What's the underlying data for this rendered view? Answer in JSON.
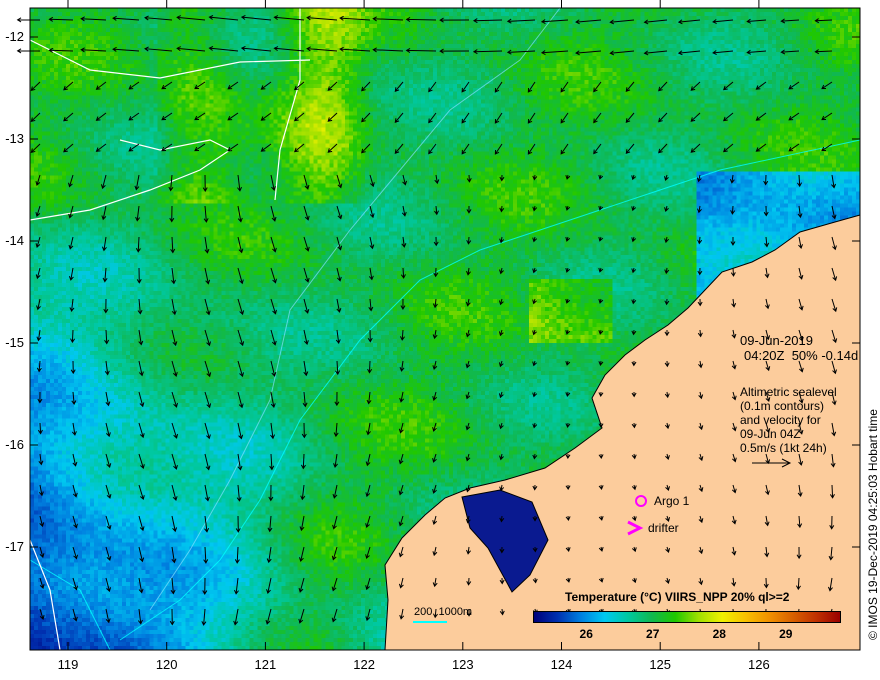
{
  "map": {
    "lat_ticks": [
      "-12",
      "-13",
      "-14",
      "-15",
      "-16",
      "-17"
    ],
    "lon_ticks": [
      "119",
      "120",
      "121",
      "122",
      "123",
      "124",
      "125",
      "126"
    ],
    "date": "09-Jun-2019",
    "time_line": "04:20Z  50% -0.14d",
    "altimetry_lines": [
      "Altimetric sealevel",
      "(0.1m contours)",
      "and velocity for",
      "09-Jun 04Z",
      "0.5m/s (1kt 24h)"
    ],
    "argo_label": "Argo 1",
    "drifter_label": "drifter",
    "depth_label": "200  1000m",
    "credit": "© IMOS 19-Dec-2019 04:25:03 Hobart time",
    "colors": {
      "land": "#fccc9c",
      "argo": "#ff00ff",
      "contour_200": "#00ffff",
      "contour_sealevel": "#ffffff"
    }
  },
  "colorbar": {
    "title": "Temperature (°C) VIIRS_NPP 20% ql>=2",
    "ticks": [
      "26",
      "27",
      "28",
      "29"
    ],
    "range": [
      25.2,
      29.8
    ]
  }
}
